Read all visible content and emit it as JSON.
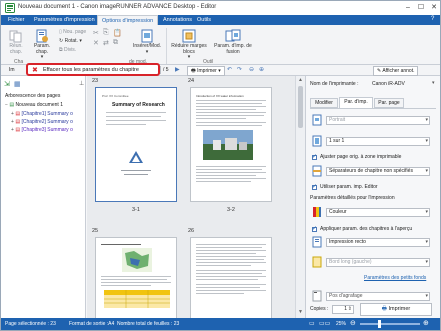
{
  "window": {
    "title": "Nouveau document 1 - Canon imageRUNNER ADVANCE Desktop - Editor",
    "controls": [
      "–",
      "☐",
      "✕"
    ]
  },
  "ribbon_tabs": [
    "Fichier",
    "Paramètres d'impression",
    "Options d'impression",
    "Annotations",
    "Outils"
  ],
  "ribbon": {
    "btn_reun_chap": "Réun. chap.",
    "btn_param_chap": "Param. chap.",
    "btn_nou_page": "Nou. page",
    "btn_rotat": "Rotat.",
    "btn_divis": "Divis.",
    "btn_inserer_mod": "Insérer/Mod.",
    "btn_reduire": "Réduire marges blocs",
    "btn_param_fusion": "Param. d'imp. de fusion",
    "grp_char": "Cha",
    "grp_mod": "de mod.",
    "grp_outil": "Outil"
  },
  "toolbar2": {
    "left_fragment": "Im",
    "page_input": "1",
    "page_total": "/ 5",
    "print_button": "Imprimer",
    "annotation_button": "Afficher annot."
  },
  "tooltip": {
    "text": "Effacer tous les paramètres du chapitre"
  },
  "left_panel": {
    "title": "Arborescence des pages",
    "items": [
      {
        "label": "Nouveau document 1",
        "color": "#1a1a1a"
      },
      {
        "label": "[Chapitre1] Summary o",
        "color": "#2a3a9c"
      },
      {
        "label": "[Chapitre2] Summary o",
        "color": "#2a3a9c"
      },
      {
        "label": "[Chapitre3] Summary o",
        "color": "#5a2ac0"
      }
    ]
  },
  "preview": {
    "pages": [
      {
        "num": "23",
        "label": "3-1",
        "heading_small": "Prof. XX Committee",
        "heading": "Summary of Research"
      },
      {
        "num": "24",
        "label": "3-2",
        "heading_small": "Introduction of XX water information",
        "heading": ""
      },
      {
        "num": "25",
        "label": "",
        "heading_small": "",
        "heading": ""
      },
      {
        "num": "26",
        "label": "",
        "heading_small": "",
        "heading": ""
      }
    ]
  },
  "right_panel": {
    "printer_label": "Nom de l'imprimante :",
    "printer_value": "Canon iR-ADV",
    "tabs": [
      "Modifier",
      "Par. d'imp.",
      "Par. page"
    ],
    "orientation": "Portrait",
    "pages_per_sheet": "1 sur 1",
    "adjust_label": "Ajuster page orig. à zone imprimable",
    "separator_value": "Séparateurs de chapitre non spécifiés",
    "use_editor_label": "Utiliser param. imp. Editor",
    "detail_label": "Paramètres détaillés pour l'impression",
    "color_value": "Couleur",
    "apply_label": "Appliquer param. des chapitres à l'aperçu",
    "duplex_value": "Impression recto",
    "binding_value": "Bord long (gauche)",
    "small_params_link": "Paramètres des petits fonds",
    "stapling_value": "Pos d'agrafage",
    "copies_label": "Copies :",
    "copies_value": "1",
    "print_button": "Imprimer"
  },
  "status": {
    "selected": "Page sélectionnée : 23",
    "format": "Format de sortie :A4",
    "sheets": "Nombre total de feuilles : 23",
    "zoom": "25%"
  }
}
